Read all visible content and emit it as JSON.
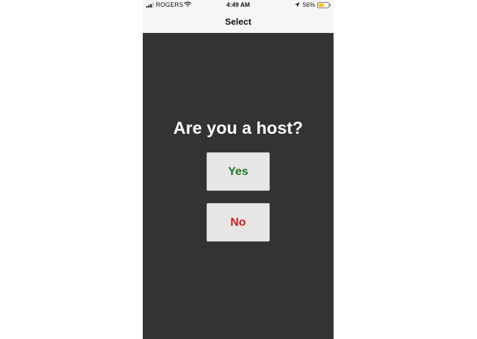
{
  "status_bar": {
    "carrier": "ROGERS",
    "time": "4:49 AM",
    "battery_percent": "56%",
    "battery_level": 0.56,
    "icons": [
      "signal-icon",
      "wifi-icon",
      "location-icon",
      "battery-icon"
    ]
  },
  "nav": {
    "title": "Select"
  },
  "main": {
    "question": "Are you a host?",
    "yes_label": "Yes",
    "no_label": "No"
  },
  "colors": {
    "background": "#333333",
    "nav_background": "#f6f6f6",
    "yes_text": "#1e7a1e",
    "no_text": "#cc1f1f",
    "button_background": "#e6e6e6",
    "battery_fill": "#f5c518"
  }
}
